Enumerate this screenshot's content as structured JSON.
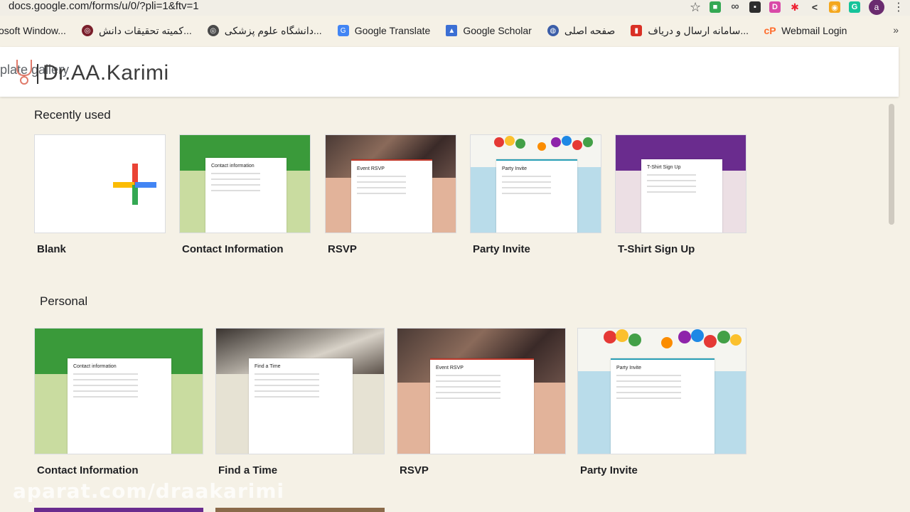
{
  "browser": {
    "url": "docs.google.com/forms/u/0/?pli=1&ftv=1",
    "profile_initial": "a"
  },
  "bookmarks": {
    "items": [
      {
        "label": "osoft Window..."
      },
      {
        "label": "کمیته تحقیقات دانش..."
      },
      {
        "label": "دانشگاه علوم پزشکی..."
      },
      {
        "label": "Google Translate"
      },
      {
        "label": "Google Scholar"
      },
      {
        "label": "صفحه اصلی"
      },
      {
        "label": "سامانه ارسال و دریاف..."
      },
      {
        "label": "Webmail Login"
      }
    ],
    "more": "»"
  },
  "header": {
    "underlay_text": "plate gallery",
    "watermark_name": "Dr.AA.Karimi"
  },
  "sections": {
    "recent": {
      "title": "Recently used",
      "cards": [
        {
          "label": "Blank"
        },
        {
          "label": "Contact Information",
          "form_title": "Contact information"
        },
        {
          "label": "RSVP",
          "form_title": "Event RSVP"
        },
        {
          "label": "Party Invite",
          "form_title": "Party Invite"
        },
        {
          "label": "T-Shirt Sign Up",
          "form_title": "T-Shirt Sign Up"
        }
      ]
    },
    "personal": {
      "title": "Personal",
      "cards": [
        {
          "label": "Contact Information",
          "form_title": "Contact information"
        },
        {
          "label": "Find a Time",
          "form_title": "Find a Time"
        },
        {
          "label": "RSVP",
          "form_title": "Event RSVP"
        },
        {
          "label": "Party Invite",
          "form_title": "Party Invite"
        }
      ]
    }
  },
  "footer_watermark": "aparat.com/draakarimi",
  "colors": {
    "page_bg": "#f5f1e6",
    "green_theme": "#3a9a3a",
    "green_bg": "#c9dca0",
    "rsvp_bg": "#e2b39a",
    "party_bg": "#b9dcea",
    "tshirt_top": "#6a2c8e",
    "tshirt_bg": "#ecdfe4",
    "findtime_bg": "#e6e2d3"
  }
}
